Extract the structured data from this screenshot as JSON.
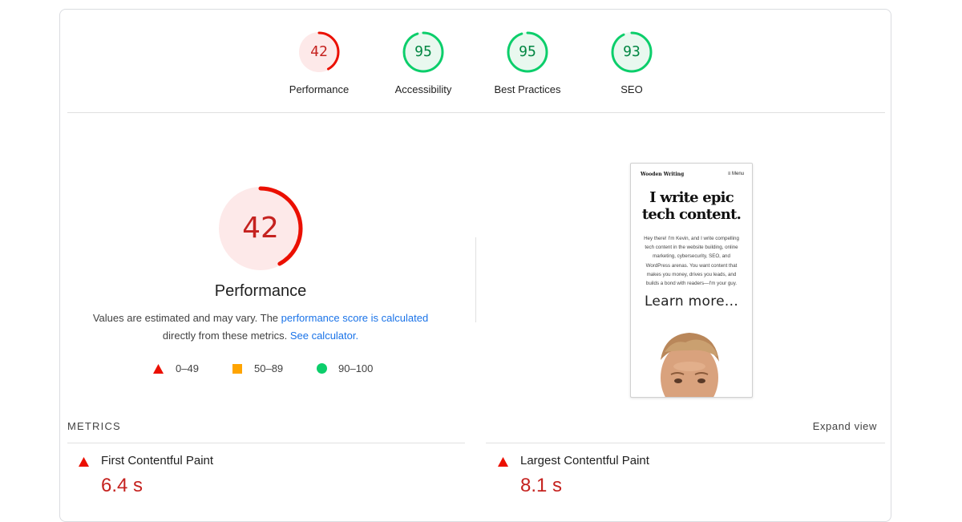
{
  "gauges": [
    {
      "label": "Performance",
      "score": "42",
      "value": 42,
      "status": "fail"
    },
    {
      "label": "Accessibility",
      "score": "95",
      "value": 95,
      "status": "pass"
    },
    {
      "label": "Best Practices",
      "score": "95",
      "value": 95,
      "status": "pass"
    },
    {
      "label": "SEO",
      "score": "93",
      "value": 93,
      "status": "pass"
    }
  ],
  "colors": {
    "fail": "#eb0f00",
    "fail_text": "#c5221f",
    "fail_bg": "#fde9e9",
    "average": "#ffa400",
    "pass": "#0cce6b",
    "pass_text": "#018642",
    "pass_bg": "#e9f8ef",
    "link": "#1a73e8"
  },
  "main": {
    "score": "42",
    "value": 42,
    "title": "Performance",
    "desc_text_1": "Values are estimated and may vary. The ",
    "desc_link_1": "performance score is calculated",
    "desc_text_2": "directly from these metrics. ",
    "desc_link_2": "See calculator."
  },
  "legend": [
    {
      "icon": "triangle-icon",
      "range": "0–49"
    },
    {
      "icon": "square-icon",
      "range": "50–89"
    },
    {
      "icon": "circle-icon",
      "range": "90–100"
    }
  ],
  "screenshot": {
    "brand": "Wooden Writing",
    "menu": "≡ Menu",
    "headline_1": "I write epic",
    "headline_2": "tech content.",
    "body_lines": [
      "Hey there! I'm Kevin, and I write compelling",
      "tech content in the website building, online",
      "marketing, cybersecurity, SEO, and",
      "WordPress arenas. You want content that",
      "makes you money, drives you leads, and",
      "builds a bond with readers—I'm your guy."
    ],
    "learn_more": "Learn more..."
  },
  "metrics": {
    "header": "METRICS",
    "expand": "Expand view",
    "items": [
      {
        "name": "First Contentful Paint",
        "value": "6.4 s"
      },
      {
        "name": "Largest Contentful Paint",
        "value": "8.1 s"
      }
    ]
  }
}
